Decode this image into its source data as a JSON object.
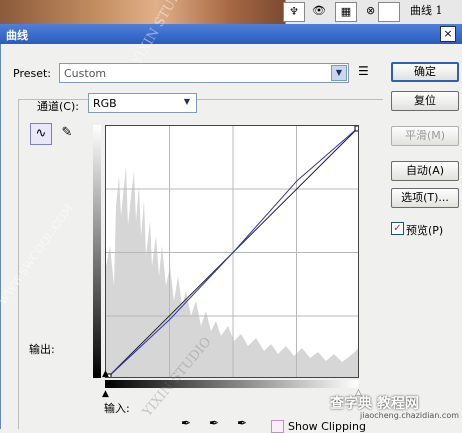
{
  "background": {
    "layer_name": "曲线 1"
  },
  "titlebar": {
    "title": "曲线",
    "close_label": "×"
  },
  "preset": {
    "label": "Preset:",
    "value": "Custom"
  },
  "channel": {
    "label": "通道(C):",
    "value": "RGB"
  },
  "buttons": {
    "ok": "确定",
    "reset": "复位",
    "smooth": "平滑(M)",
    "auto": "自动(A)",
    "options": "选项(T)..."
  },
  "preview": {
    "label": "预览(P)",
    "checked": true
  },
  "graph": {
    "output_label": "输出:",
    "input_label": "输入:",
    "curve_points": [
      [
        0,
        0
      ],
      [
        64,
        60
      ],
      [
        128,
        128
      ],
      [
        192,
        200
      ],
      [
        255,
        255
      ]
    ]
  },
  "show_clipping": {
    "label": "Show Clipping"
  },
  "watermarks": {
    "left": "WWW.SWCOOL.COM",
    "center": "YIXIN STUDIO",
    "center2": "YIXIN STUDIO",
    "footer": "查字典 教程网",
    "url": "jiaocheng.chazidian.com"
  },
  "colors": {
    "curve": "#3030c0",
    "histogram": "#d6d6d6",
    "titlebar": "#2a5cc0"
  }
}
